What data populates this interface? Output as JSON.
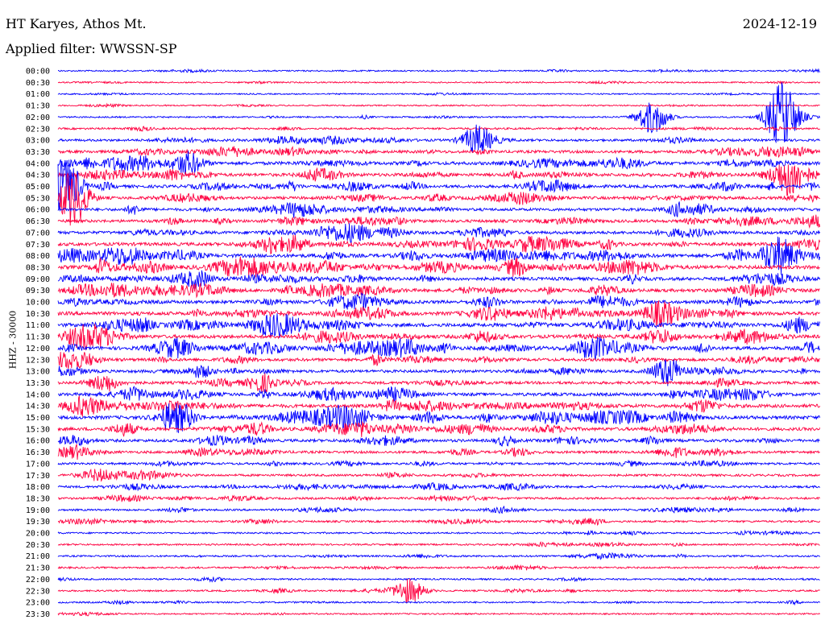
{
  "header": {
    "station": "HT Karyes, Athos Mt.",
    "date": "2024-12-19",
    "filter": "Applied filter: WWSSN-SP"
  },
  "chart_data": {
    "type": "line",
    "title": "HT Karyes, Athos Mt.",
    "ylabel": "HHZ - 30000",
    "colors": [
      "#0000ff",
      "#ff0040"
    ],
    "row_times": [
      "00:00",
      "00:30",
      "01:00",
      "01:30",
      "02:00",
      "02:30",
      "03:00",
      "03:30",
      "04:00",
      "04:30",
      "05:00",
      "05:30",
      "06:00",
      "06:30",
      "07:00",
      "07:30",
      "08:00",
      "08:30",
      "09:00",
      "09:30",
      "10:00",
      "10:30",
      "11:00",
      "11:30",
      "12:00",
      "12:30",
      "13:00",
      "13:30",
      "14:00",
      "14:30",
      "15:00",
      "15:30",
      "16:00",
      "16:30",
      "17:00",
      "17:30",
      "18:00",
      "18:30",
      "19:00",
      "19:30",
      "20:00",
      "20:30",
      "21:00",
      "21:30",
      "22:00",
      "22:30",
      "23:00",
      "23:30"
    ],
    "activity": [
      0.15,
      0.12,
      0.1,
      0.12,
      0.18,
      0.3,
      0.45,
      0.6,
      0.75,
      0.7,
      0.65,
      0.6,
      0.6,
      0.62,
      0.65,
      0.75,
      0.85,
      0.85,
      0.75,
      0.75,
      0.75,
      0.85,
      0.85,
      0.8,
      0.8,
      0.65,
      0.6,
      0.6,
      0.7,
      0.8,
      0.8,
      0.7,
      0.6,
      0.5,
      0.4,
      0.4,
      0.4,
      0.35,
      0.3,
      0.3,
      0.22,
      0.22,
      0.25,
      0.25,
      0.22,
      0.22,
      0.2,
      0.15
    ],
    "events": [
      {
        "row": 4,
        "x": 0.95,
        "amp": 6,
        "color": 0
      },
      {
        "row": 4,
        "x": 0.78,
        "amp": 3,
        "color": 0
      },
      {
        "row": 6,
        "x": 0.55,
        "amp": 2.5,
        "color": 0
      },
      {
        "row": 10,
        "x": 0.01,
        "amp": 5,
        "color": 1
      },
      {
        "row": 11,
        "x": 0.02,
        "amp": 5,
        "color": 1
      },
      {
        "row": 8,
        "x": 0.17,
        "amp": 2,
        "color": 0
      },
      {
        "row": 9,
        "x": 0.96,
        "amp": 3,
        "color": 0
      },
      {
        "row": 16,
        "x": 0.95,
        "amp": 2.5,
        "color": 0
      },
      {
        "row": 26,
        "x": 0.8,
        "amp": 2.5,
        "color": 0
      },
      {
        "row": 30,
        "x": 0.16,
        "amp": 2.5,
        "color": 0
      },
      {
        "row": 45,
        "x": 0.46,
        "amp": 2,
        "color": 1
      }
    ]
  }
}
